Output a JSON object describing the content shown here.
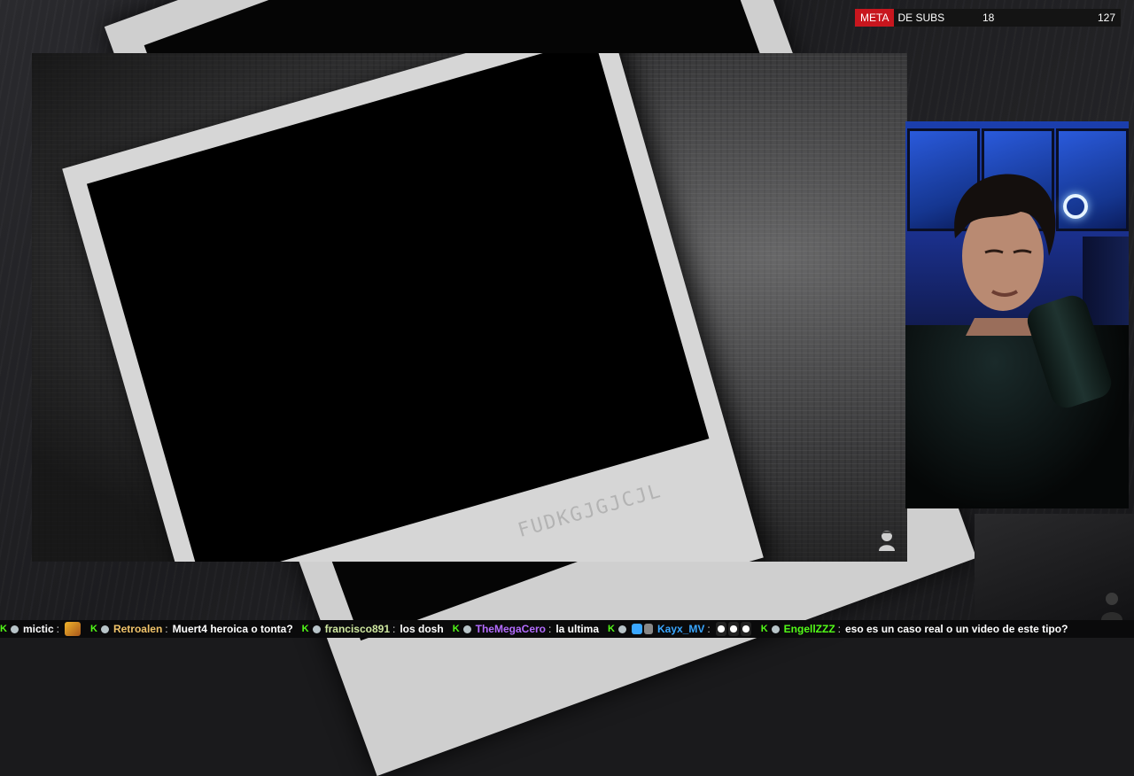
{
  "subs_goal": {
    "label_highlight": "META",
    "label_rest": "DE SUBS",
    "current": "18",
    "goal": "127",
    "accent_color": "#c8161e"
  },
  "stage": {
    "caption": "FUDKGJGJCJL"
  },
  "chat": [
    {
      "user": "mictic",
      "user_color": "#ffffff",
      "text": "",
      "emote": "pixel-emote",
      "has_emote": true
    },
    {
      "user": "Retroalen",
      "user_color": "#f0c36a",
      "text": "Muert4 heroica o tonta?"
    },
    {
      "user": "francisco891",
      "user_color": "#cfe8a0",
      "text": "los dosh"
    },
    {
      "user": "TheMegaCero",
      "user_color": "#b46cff",
      "text": "la ultima"
    },
    {
      "user": "Kayx_MV",
      "user_color": "#3aa7ff",
      "text": "",
      "emotes": 3
    },
    {
      "user": "EngellZZZ",
      "user_color": "#53fc18",
      "text": "eso es un caso real o un video de este tipo?"
    }
  ],
  "colors": {
    "kick_green": "#53fc18",
    "webcam_blue": "#1b3fae"
  }
}
